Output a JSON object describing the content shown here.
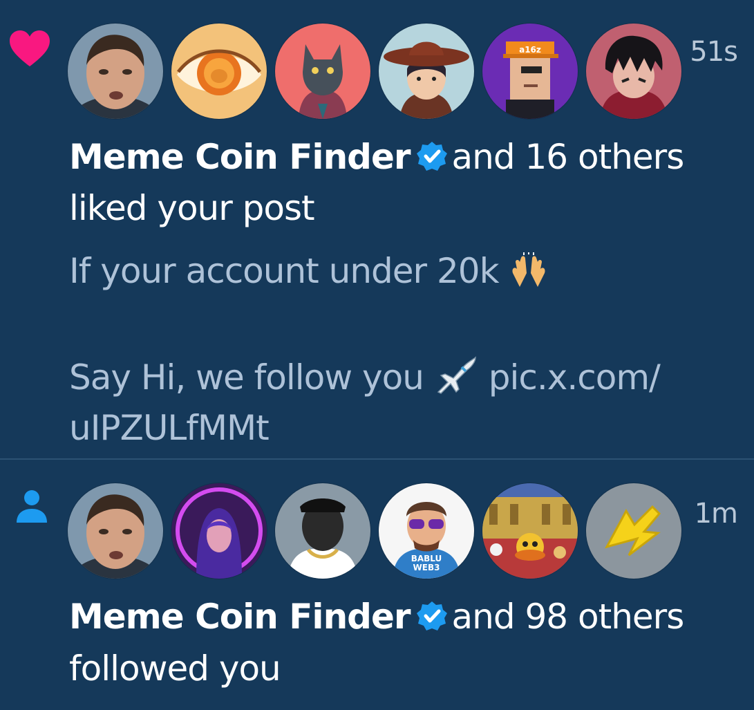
{
  "notifications": [
    {
      "type_icon": "heart-icon",
      "time": "51s",
      "name": "Meme Coin Finder",
      "others": "and 16 others",
      "action": "liked your post",
      "post_line1": "If your account under 20k",
      "post_line1_emoji": "raising-hands-emoji",
      "post_line2": "Say Hi, we follow you",
      "post_line2_emoji": "airplane-emoji",
      "post_link_part1": "pic.x.com/",
      "post_link_part2": "uIPZULfMMt",
      "badge_text": "a16z"
    },
    {
      "type_icon": "person-icon",
      "time": "1m",
      "name": "Meme Coin Finder",
      "others": "and 98 others",
      "action": "followed you",
      "badge_text_line1": "BABLU",
      "badge_text_line2": "WEB3"
    }
  ],
  "colors": {
    "background": "#15395a",
    "heart": "#f91880",
    "person": "#1d9bf0",
    "verified": "#1d9bf0",
    "muted_text": "#aec2d8"
  }
}
